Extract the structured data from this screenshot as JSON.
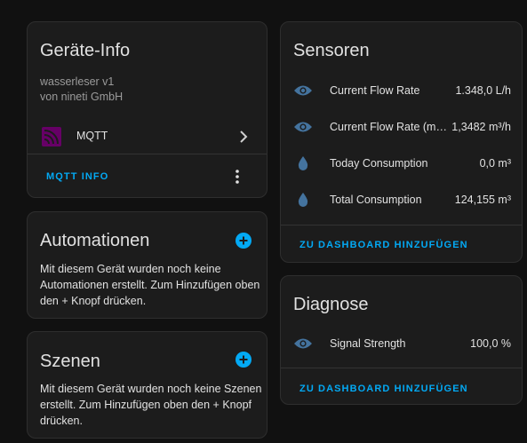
{
  "device_info": {
    "title": "Geräte-Info",
    "model": "wasserleser v1",
    "manufacturer": "von nineti GmbH",
    "integration_label": "MQTT",
    "action_label": "MQTT INFO",
    "icons": {
      "integration": "mqtt-logo-icon",
      "chevron": "chevron-right-icon",
      "menu": "overflow-menu-icon"
    }
  },
  "automations": {
    "title": "Automationen",
    "text": "Mit diesem Gerät wurden noch keine Automationen erstellt. Zum Hinzufügen oben den + Knopf drücken.",
    "icon": "plus-circle-icon"
  },
  "scenes": {
    "title": "Szenen",
    "text": "Mit diesem Gerät wurden noch keine Szenen erstellt. Zum Hinzufügen oben den + Knopf drücken.",
    "icon": "plus-circle-icon"
  },
  "sensors": {
    "title": "Sensoren",
    "rows": [
      {
        "icon": "eye-icon",
        "label": "Current Flow Rate",
        "value": "1.348,0 L/h"
      },
      {
        "icon": "eye-icon",
        "label": "Current Flow Rate (m³…",
        "value": "1,3482 m³/h"
      },
      {
        "icon": "water-drop-icon",
        "label": "Today Consumption",
        "value": "0,0 m³"
      },
      {
        "icon": "water-drop-icon",
        "label": "Total Consumption",
        "value": "124,155 m³"
      }
    ],
    "action_label": "ZU DASHBOARD HINZUFÜGEN"
  },
  "diagnostics": {
    "title": "Diagnose",
    "rows": [
      {
        "icon": "eye-icon",
        "label": "Signal Strength",
        "value": "100,0 %"
      }
    ],
    "action_label": "ZU DASHBOARD HINZUFÜGEN"
  },
  "colors": {
    "background": "#111111",
    "card": "#1c1c1c",
    "accent": "#03a9f4",
    "entity_icon": "#44739e",
    "mqtt_logo": "#660066"
  }
}
